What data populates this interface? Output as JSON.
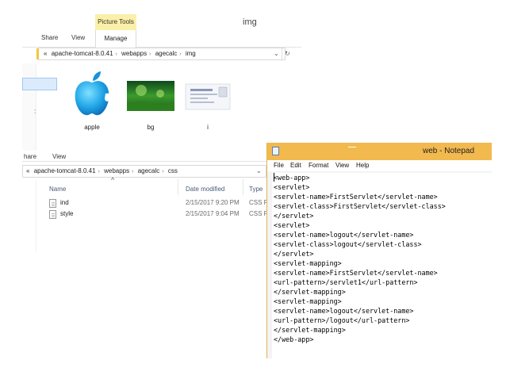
{
  "img_window": {
    "contextual_tab": "Picture Tools",
    "title": "img",
    "ribbon_tabs": [
      "Share",
      "View"
    ],
    "manage_tab": "Manage",
    "address_segments": [
      "apache-tomcat-8.0.41",
      "webapps",
      "agecalc",
      "img"
    ],
    "address_prefix": "«",
    "thumbnails": [
      {
        "name": "apple",
        "icon": "apple-logo-image"
      },
      {
        "name": "bg",
        "icon": "green-background-image"
      },
      {
        "name": "i",
        "icon": "screenshot-image"
      }
    ]
  },
  "css_window": {
    "ribbon_tabs": [
      "hare",
      "View"
    ],
    "address_prefix": "«",
    "address_segments": [
      "apache-tomcat-8.0.41",
      "webapps",
      "agecalc",
      "css"
    ],
    "columns": [
      "Name",
      "Date modified",
      "Type"
    ],
    "sort_indicator": "^",
    "files": [
      {
        "name": "ind",
        "date": "2/15/2017 9:20 PM",
        "type": "CSS Fi"
      },
      {
        "name": "style",
        "date": "2/15/2017 9:04 PM",
        "type": "CSS Fi"
      }
    ]
  },
  "notepad": {
    "title": "web - Notepad",
    "menu": [
      "File",
      "Edit",
      "Format",
      "View",
      "Help"
    ],
    "lines": [
      "<web-app>",
      "<servlet>",
      "<servlet-name>FirstServlet</servlet-name>",
      "<servlet-class>FirstServlet</servlet-class>",
      "</servlet>",
      "<servlet>",
      "<servlet-name>logout</servlet-name>",
      "<servlet-class>logout</servlet-class>",
      "</servlet>",
      "<servlet-mapping>",
      "<servlet-name>FirstServlet</servlet-name>",
      "<url-pattern>/servlet1</url-pattern>",
      "</servlet-mapping>",
      "<servlet-mapping>",
      "<servlet-name>logout</servlet-name>",
      "<url-pattern>/logout</url-pattern>",
      "</servlet-mapping>",
      "</web-app>"
    ]
  },
  "colors": {
    "picture_tools_tab": "#fbf0a8",
    "notepad_titlebar": "#f2b94f",
    "selection": "#dcebfc",
    "column_header_text": "#4a5b78"
  }
}
